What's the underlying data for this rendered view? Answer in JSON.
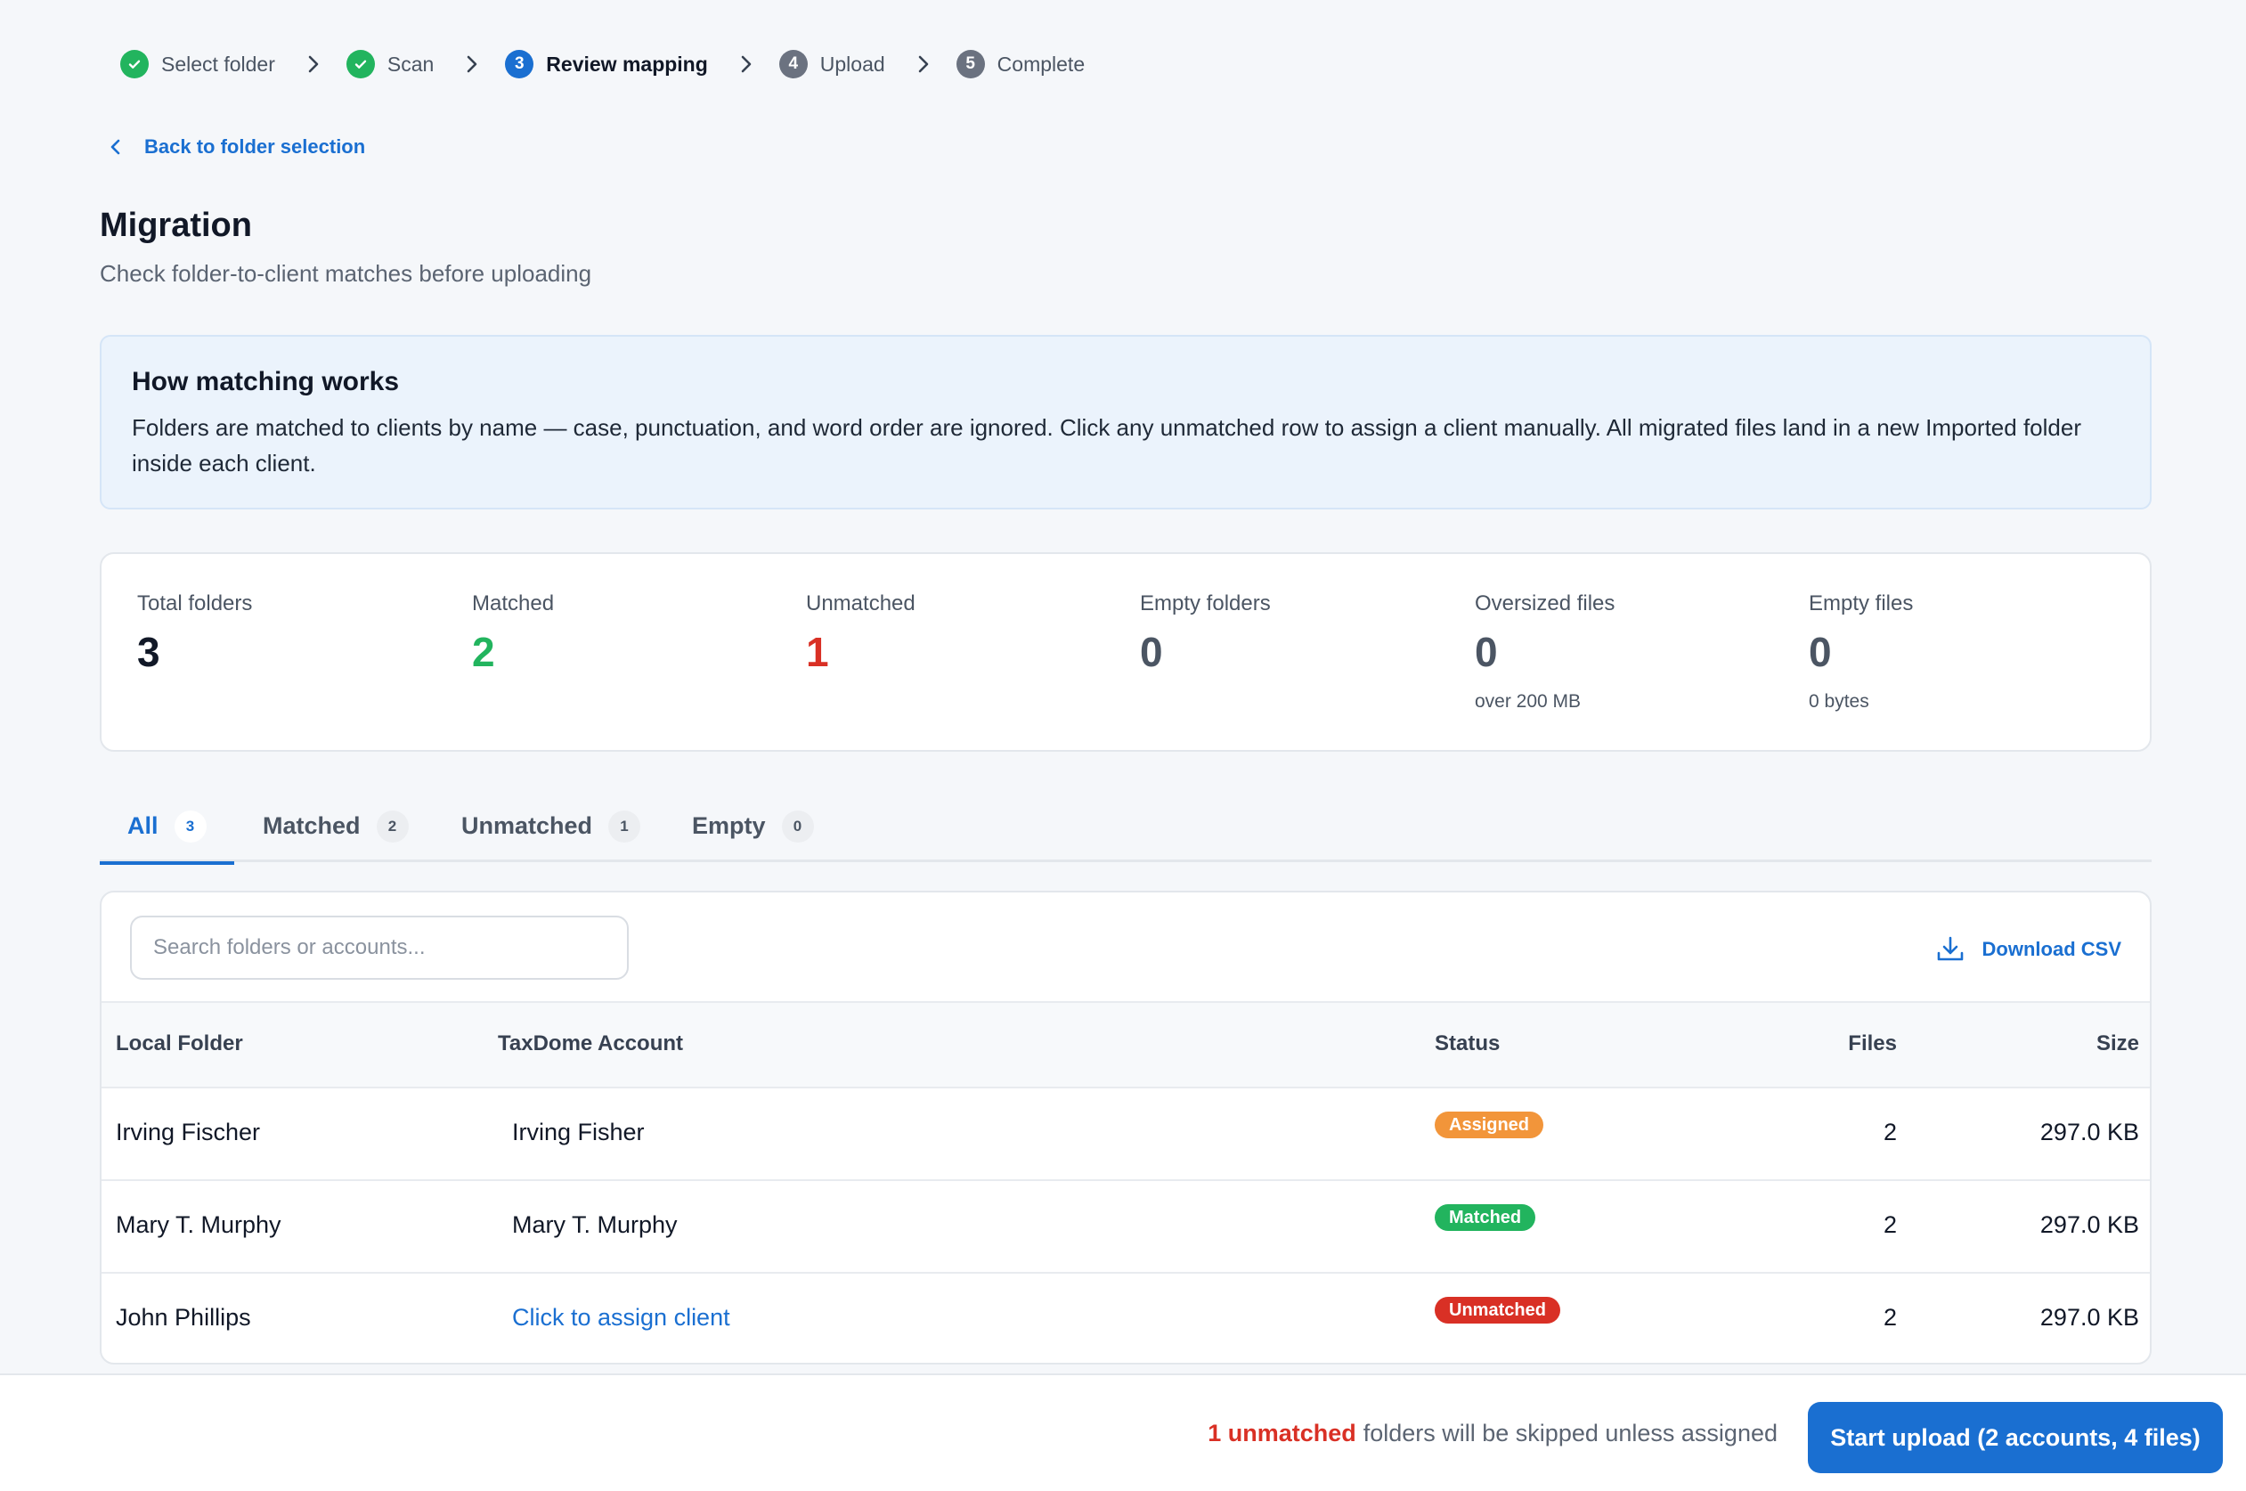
{
  "stepper": {
    "steps": [
      {
        "label": "Select folder",
        "state": "done",
        "number": "1"
      },
      {
        "label": "Scan",
        "state": "done",
        "number": "2"
      },
      {
        "label": "Review mapping",
        "state": "current",
        "number": "3"
      },
      {
        "label": "Upload",
        "state": "pending",
        "number": "4"
      },
      {
        "label": "Complete",
        "state": "pending",
        "number": "5"
      }
    ],
    "icons": {
      "done": "check-icon",
      "separator": "chevron-right-icon"
    }
  },
  "back_link": {
    "label": "Back to folder selection",
    "icon": "chevron-left-icon"
  },
  "header": {
    "title": "Migration",
    "subtitle": "Check folder-to-client matches before uploading"
  },
  "info": {
    "title": "How matching works",
    "text": "Folders are matched to clients by name — case, punctuation, and word order are ignored. Click any unmatched row to assign a client manually. All migrated files land in a new Imported folder inside each client."
  },
  "stats": [
    {
      "label": "Total folders",
      "value": "3",
      "note": "",
      "color": "#111827"
    },
    {
      "label": "Matched",
      "value": "2",
      "note": "",
      "color": "#22b45e"
    },
    {
      "label": "Unmatched",
      "value": "1",
      "note": "",
      "color": "#d93025"
    },
    {
      "label": "Empty folders",
      "value": "0",
      "note": "",
      "color": "#4b5563"
    },
    {
      "label": "Oversized files",
      "value": "0",
      "note": "over 200 MB",
      "color": "#4b5563"
    },
    {
      "label": "Empty files",
      "value": "0",
      "note": "0 bytes",
      "color": "#4b5563"
    }
  ],
  "tabs": [
    {
      "label": "All",
      "count": "3",
      "active": true
    },
    {
      "label": "Matched",
      "count": "2",
      "active": false
    },
    {
      "label": "Unmatched",
      "count": "1",
      "active": false
    },
    {
      "label": "Empty",
      "count": "0",
      "active": false
    }
  ],
  "table": {
    "search_placeholder": "Search folders or accounts...",
    "download_label": "Download CSV",
    "download_icon": "download-icon",
    "columns": {
      "folder": "Local Folder",
      "account": "TaxDome Account",
      "status": "Status",
      "files": "Files",
      "size": "Size"
    },
    "rows": [
      {
        "folder": "Irving Fischer",
        "account": "Irving Fisher",
        "account_is_link": false,
        "status": "Assigned",
        "status_color": "#f2953a",
        "files": "2",
        "size": "297.0 KB"
      },
      {
        "folder": "Mary T. Murphy",
        "account": "Mary T. Murphy",
        "account_is_link": false,
        "status": "Matched",
        "status_color": "#22b45e",
        "files": "2",
        "size": "297.0 KB"
      },
      {
        "folder": "John Phillips",
        "account": "Click to assign client",
        "account_is_link": true,
        "status": "Unmatched",
        "status_color": "#d93025",
        "files": "2",
        "size": "297.0 KB"
      }
    ]
  },
  "footer": {
    "warning_count": "1 unmatched",
    "warning_text": "folders will be skipped unless assigned",
    "start_label": "Start upload (2 accounts, 4 files)"
  },
  "colors": {
    "accent": "#1a6fd1",
    "success": "#22b45e",
    "danger": "#d93025",
    "warning": "#f2953a"
  }
}
